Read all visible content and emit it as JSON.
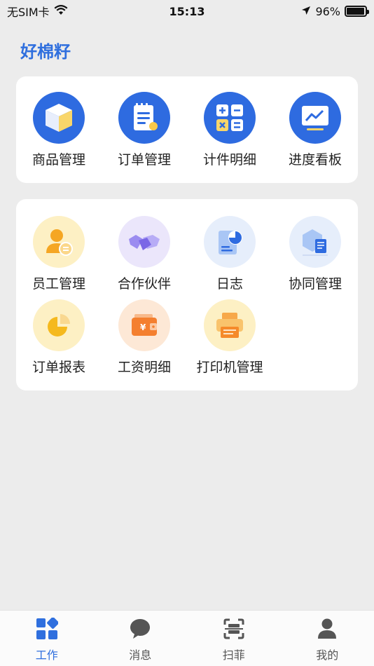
{
  "status_bar": {
    "carrier": "无SIM卡",
    "time": "15:13",
    "battery_percent": "96%",
    "battery_level": 0.96
  },
  "app": {
    "title": "好棉籽"
  },
  "section_main": {
    "items": [
      {
        "label": "商品管理",
        "icon": "product-box-icon"
      },
      {
        "label": "订单管理",
        "icon": "order-notepad-icon"
      },
      {
        "label": "计件明细",
        "icon": "calculator-icon"
      },
      {
        "label": "进度看板",
        "icon": "progress-chart-icon"
      }
    ]
  },
  "section_more": {
    "items": [
      {
        "label": "员工管理",
        "icon": "employee-icon"
      },
      {
        "label": "合作伙伴",
        "icon": "handshake-icon"
      },
      {
        "label": "日志",
        "icon": "log-document-icon"
      },
      {
        "label": "协同管理",
        "icon": "collaboration-icon"
      },
      {
        "label": "订单报表",
        "icon": "pie-chart-icon"
      },
      {
        "label": "工资明细",
        "icon": "wallet-icon"
      },
      {
        "label": "打印机管理",
        "icon": "printer-icon"
      }
    ]
  },
  "tab_bar": {
    "tabs": [
      {
        "label": "工作",
        "icon": "work-grid-icon",
        "active": true
      },
      {
        "label": "消息",
        "icon": "message-bubble-icon",
        "active": false
      },
      {
        "label": "扫菲",
        "icon": "scan-icon",
        "active": false
      },
      {
        "label": "我的",
        "icon": "profile-icon",
        "active": false
      }
    ]
  },
  "colors": {
    "accent": "#2f6fde",
    "background": "#ececec",
    "inactive_tab": "#555555"
  }
}
